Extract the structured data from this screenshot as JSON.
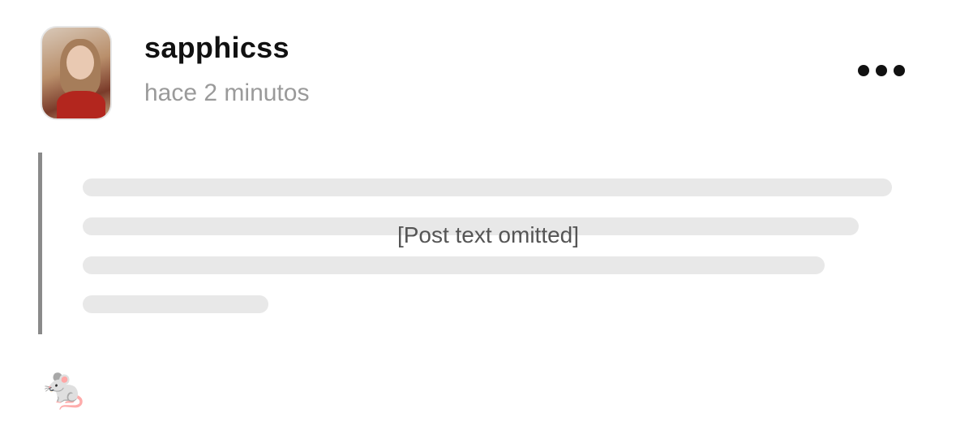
{
  "post": {
    "username": "sapphicss",
    "timestamp": "hace 2 minutos",
    "body_note": "[Post text omitted]",
    "reaction_emoji": "🐁"
  },
  "icons": {
    "more": "more-horizontal-icon"
  }
}
